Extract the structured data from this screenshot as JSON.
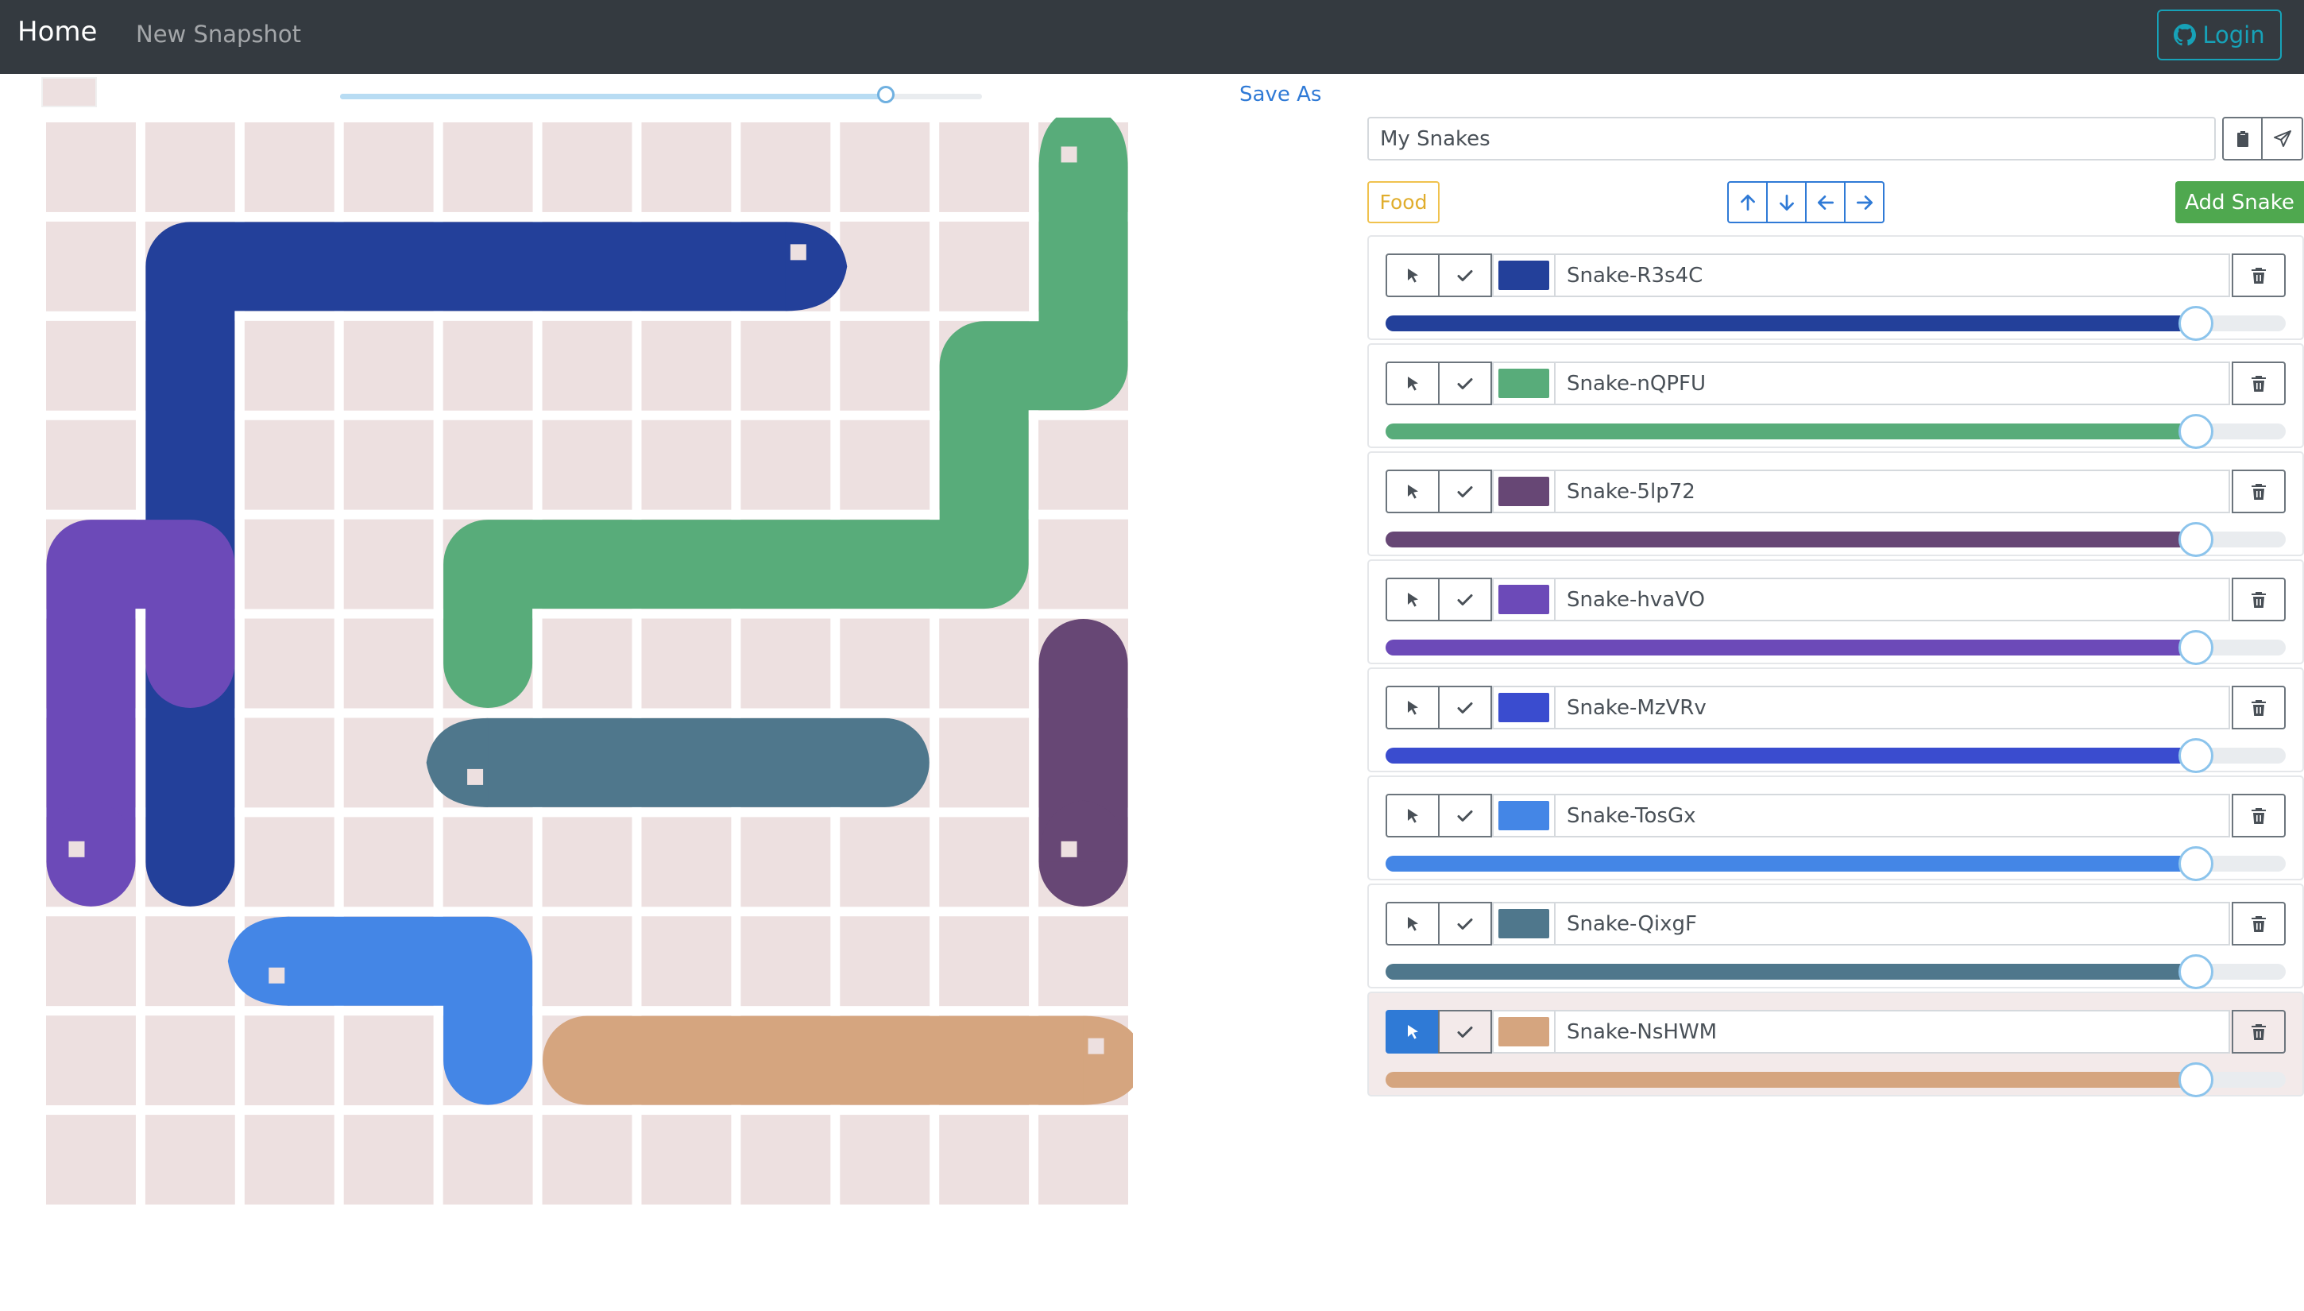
{
  "navbar": {
    "brand": "Home",
    "new_snapshot": "New Snapshot",
    "login": "Login"
  },
  "toolbar": {
    "save_as": "Save As",
    "turn_slider": 0.85
  },
  "board": {
    "size": 11,
    "cell_color": "#ede0e0",
    "eye_color": "#ede0e0",
    "snakes": [
      {
        "color": "#23409a",
        "head_dir": "right",
        "body": [
          [
            7,
            1
          ],
          [
            6,
            1
          ],
          [
            5,
            1
          ],
          [
            4,
            1
          ],
          [
            3,
            1
          ],
          [
            2,
            1
          ],
          [
            1,
            1
          ],
          [
            1,
            2
          ],
          [
            1,
            3
          ],
          [
            1,
            4
          ],
          [
            1,
            5
          ],
          [
            1,
            6
          ],
          [
            1,
            7
          ]
        ]
      },
      {
        "color": "#58ac7a",
        "head_dir": "up",
        "body": [
          [
            10,
            0
          ],
          [
            10,
            1
          ],
          [
            10,
            2
          ],
          [
            9,
            2
          ],
          [
            9,
            3
          ],
          [
            9,
            4
          ],
          [
            8,
            4
          ],
          [
            7,
            4
          ],
          [
            6,
            4
          ],
          [
            5,
            4
          ],
          [
            4,
            4
          ],
          [
            4,
            5
          ]
        ]
      },
      {
        "color": "#6c4ab8",
        "head_dir": "up",
        "body": [
          [
            0,
            7
          ],
          [
            0,
            6
          ],
          [
            0,
            5
          ],
          [
            0,
            4
          ],
          [
            1,
            4
          ],
          [
            1,
            5
          ]
        ]
      },
      {
        "color": "#4f778c",
        "head_dir": "left",
        "body": [
          [
            4,
            6
          ],
          [
            5,
            6
          ],
          [
            6,
            6
          ],
          [
            7,
            6
          ],
          [
            8,
            6
          ]
        ]
      },
      {
        "color": "#674775",
        "head_dir": "up",
        "body": [
          [
            10,
            7
          ],
          [
            10,
            6
          ],
          [
            10,
            5
          ]
        ]
      },
      {
        "color": "#4486e6",
        "head_dir": "left",
        "body": [
          [
            2,
            8
          ],
          [
            3,
            8
          ],
          [
            4,
            8
          ],
          [
            4,
            9
          ]
        ]
      },
      {
        "color": "#d5a57f",
        "head_dir": "right",
        "body": [
          [
            10,
            9
          ],
          [
            9,
            9
          ],
          [
            8,
            9
          ],
          [
            7,
            9
          ],
          [
            6,
            9
          ],
          [
            5,
            9
          ]
        ]
      }
    ]
  },
  "panel": {
    "name_value": "My Snakes",
    "food": "Food",
    "add_snake": "Add Snake",
    "snakes": [
      {
        "name": "Snake-R3s4C",
        "color": "#23409a",
        "length": 0.9,
        "selected": false
      },
      {
        "name": "Snake-nQPFU",
        "color": "#58ac7a",
        "length": 0.9,
        "selected": false
      },
      {
        "name": "Snake-5lp72",
        "color": "#674775",
        "length": 0.9,
        "selected": false
      },
      {
        "name": "Snake-hvaVO",
        "color": "#6c4ab8",
        "length": 0.9,
        "selected": false
      },
      {
        "name": "Snake-MzVRv",
        "color": "#3a4ccf",
        "length": 0.9,
        "selected": false
      },
      {
        "name": "Snake-TosGx",
        "color": "#4486e6",
        "length": 0.9,
        "selected": false
      },
      {
        "name": "Snake-QixgF",
        "color": "#4f778c",
        "length": 0.9,
        "selected": false
      },
      {
        "name": "Snake-NsHWM",
        "color": "#d5a57f",
        "length": 0.9,
        "selected": true
      }
    ]
  }
}
